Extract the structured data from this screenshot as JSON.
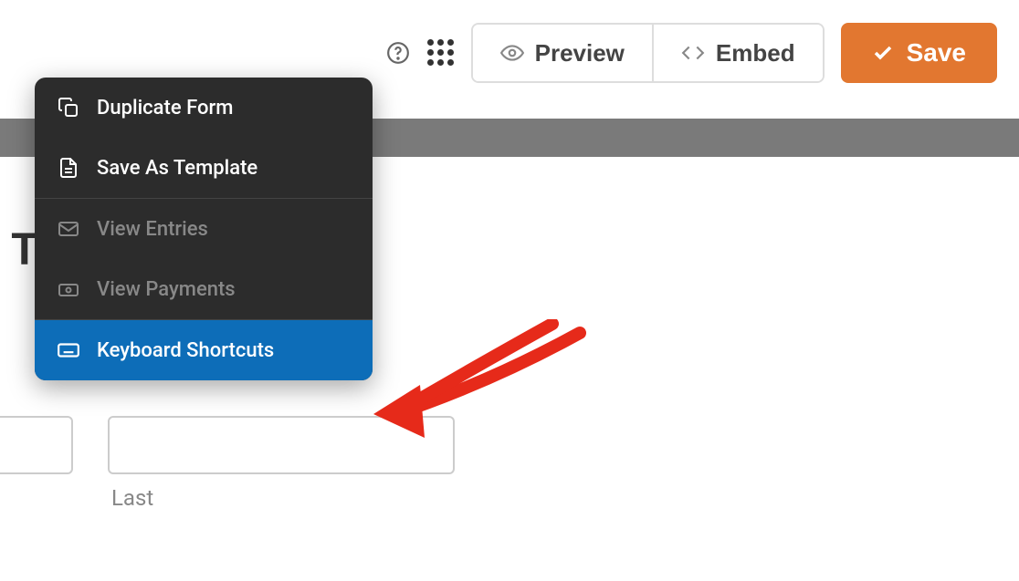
{
  "toolbar": {
    "preview_label": "Preview",
    "embed_label": "Embed",
    "save_label": "Save"
  },
  "menu": {
    "duplicate": "Duplicate Form",
    "save_template": "Save As Template",
    "view_entries": "View Entries",
    "view_payments": "View Payments",
    "keyboard_shortcuts": "Keyboard Shortcuts"
  },
  "form": {
    "partial_title": "T",
    "last_label": "Last"
  }
}
